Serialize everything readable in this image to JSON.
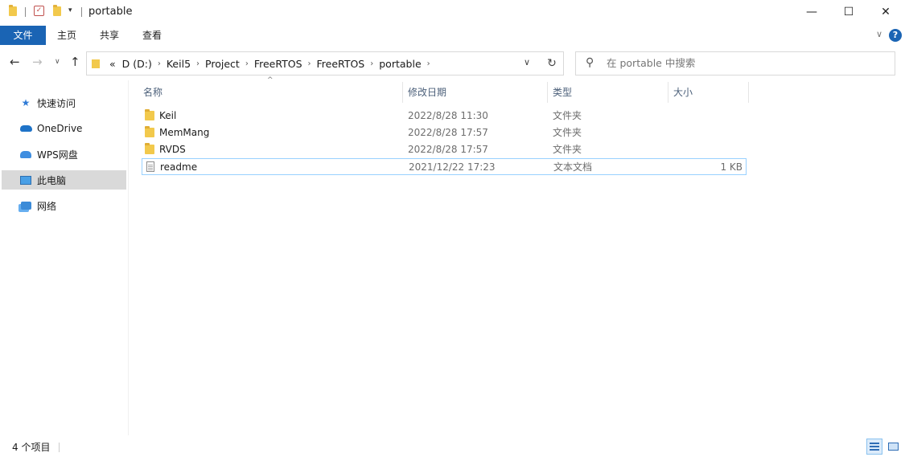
{
  "window": {
    "title": "portable",
    "minimize_icon": "—",
    "maximize_icon": "☐",
    "close_icon": "✕"
  },
  "ribbon": {
    "tabs": [
      "文件",
      "主页",
      "共享",
      "查看"
    ],
    "help_label": "?"
  },
  "address": {
    "overflow": "«",
    "crumbs": [
      "D (D:)",
      "Keil5",
      "Project",
      "FreeRTOS",
      "FreeRTOS",
      "portable"
    ]
  },
  "search": {
    "placeholder": "在 portable 中搜索"
  },
  "sidebar": {
    "items": [
      {
        "label": "快速访问",
        "icon": "star-icon"
      },
      {
        "label": "OneDrive",
        "icon": "cloud-icon"
      },
      {
        "label": "WPS网盘",
        "icon": "cloud-drive-icon"
      },
      {
        "label": "此电脑",
        "icon": "computer-icon"
      },
      {
        "label": "网络",
        "icon": "network-icon"
      }
    ]
  },
  "columns": [
    "名称",
    "修改日期",
    "类型",
    "大小"
  ],
  "files": [
    {
      "name": "Keil",
      "date": "2022/8/28 11:30",
      "type": "文件夹",
      "size": "",
      "icon": "folder-icon"
    },
    {
      "name": "MemMang",
      "date": "2022/8/28 17:57",
      "type": "文件夹",
      "size": "",
      "icon": "folder-icon"
    },
    {
      "name": "RVDS",
      "date": "2022/8/28 17:57",
      "type": "文件夹",
      "size": "",
      "icon": "folder-icon"
    },
    {
      "name": "readme",
      "date": "2021/12/22 17:23",
      "type": "文本文档",
      "size": "1 KB",
      "icon": "text-file-icon"
    }
  ],
  "status": {
    "item_count": "4 个项目"
  },
  "colors": {
    "accent": "#1a64b4",
    "folder": "#f2c94c",
    "selection_border": "#99d1ff"
  }
}
